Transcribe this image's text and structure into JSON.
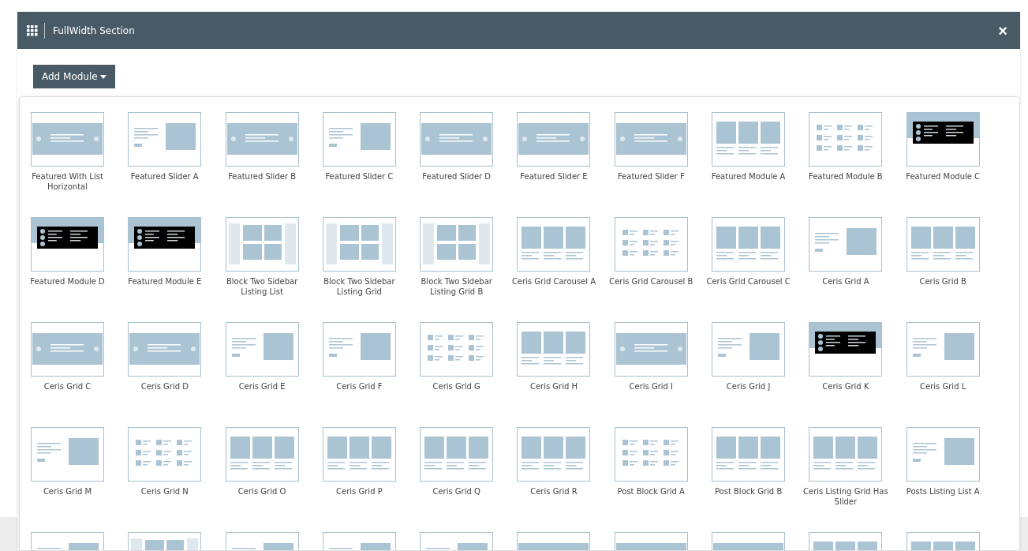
{
  "window": {
    "title": "FullWidth Section",
    "close": "×"
  },
  "add_button": {
    "label": "Add Module",
    "expanded": true
  },
  "modules": [
    {
      "label": "Featured With List Horizontal",
      "kind": "banner"
    },
    {
      "label": "Featured Slider A",
      "kind": "split"
    },
    {
      "label": "Featured Slider B",
      "kind": "banner"
    },
    {
      "label": "Featured Slider C",
      "kind": "split"
    },
    {
      "label": "Featured Slider D",
      "kind": "banner"
    },
    {
      "label": "Featured Slider E",
      "kind": "banner"
    },
    {
      "label": "Featured Slider F",
      "kind": "banner"
    },
    {
      "label": "Featured Module A",
      "kind": "grid"
    },
    {
      "label": "Featured Module B",
      "kind": "list"
    },
    {
      "label": "Featured Module C",
      "kind": "dark"
    },
    {
      "label": "Featured Module D",
      "kind": "dark"
    },
    {
      "label": "Featured Module E",
      "kind": "dark"
    },
    {
      "label": "Block Two Sidebar Listing List",
      "kind": "sidebar"
    },
    {
      "label": "Block Two Sidebar Listing Grid",
      "kind": "sidebar"
    },
    {
      "label": "Block Two Sidebar Listing Grid B",
      "kind": "sidebar"
    },
    {
      "label": "Ceris Grid Carousel A",
      "kind": "grid"
    },
    {
      "label": "Ceris Grid Carousel B",
      "kind": "list"
    },
    {
      "label": "Ceris Grid Carousel C",
      "kind": "grid"
    },
    {
      "label": "Ceris Grid A",
      "kind": "split"
    },
    {
      "label": "Ceris Grid B",
      "kind": "grid"
    },
    {
      "label": "Ceris Grid C",
      "kind": "banner"
    },
    {
      "label": "Ceris Grid D",
      "kind": "banner"
    },
    {
      "label": "Ceris Grid E",
      "kind": "split"
    },
    {
      "label": "Ceris Grid F",
      "kind": "split"
    },
    {
      "label": "Ceris Grid G",
      "kind": "list"
    },
    {
      "label": "Ceris Grid H",
      "kind": "grid"
    },
    {
      "label": "Ceris Grid I",
      "kind": "banner"
    },
    {
      "label": "Ceris Grid J",
      "kind": "split"
    },
    {
      "label": "Ceris Grid K",
      "kind": "dark"
    },
    {
      "label": "Ceris Grid L",
      "kind": "split"
    },
    {
      "label": "Ceris Grid M",
      "kind": "split"
    },
    {
      "label": "Ceris Grid N",
      "kind": "list"
    },
    {
      "label": "Ceris Grid O",
      "kind": "grid"
    },
    {
      "label": "Ceris Grid P",
      "kind": "grid"
    },
    {
      "label": "Ceris Grid Q",
      "kind": "grid"
    },
    {
      "label": "Ceris Grid R",
      "kind": "grid"
    },
    {
      "label": "Post Block Grid A",
      "kind": "list"
    },
    {
      "label": "Post Block Grid B",
      "kind": "grid"
    },
    {
      "label": "Ceris Listing Grid Has Slider",
      "kind": "grid"
    },
    {
      "label": "Posts Listing List A",
      "kind": "split"
    },
    {
      "kind": "split"
    },
    {
      "kind": "sidebar"
    },
    {
      "kind": "split"
    },
    {
      "kind": "split"
    },
    {
      "kind": "split"
    },
    {
      "kind": "banner"
    },
    {
      "kind": "banner"
    },
    {
      "kind": "banner"
    },
    {
      "kind": "grid"
    },
    {
      "kind": "grid"
    }
  ]
}
